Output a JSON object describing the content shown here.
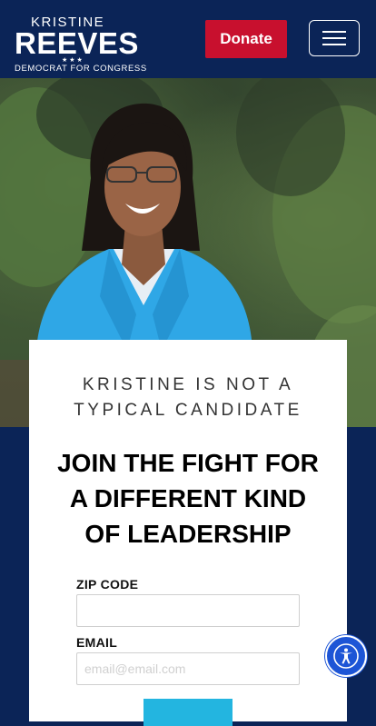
{
  "header": {
    "logo_top": "KRISTINE",
    "logo_main": "REEVES",
    "logo_stars": "★★★",
    "logo_sub": "DEMOCRAT FOR CONGRESS",
    "donate_label": "Donate"
  },
  "card": {
    "tagline_line1": "KRISTINE IS NOT A",
    "tagline_line2": "TYPICAL CANDIDATE",
    "headline_line1": "JOIN THE FIGHT FOR",
    "headline_line2": "A DIFFERENT KIND",
    "headline_line3": "OF LEADERSHIP",
    "zip_label": "ZIP CODE",
    "zip_value": "",
    "email_label": "EMAIL",
    "email_placeholder": "email@email.com"
  },
  "icons": {
    "menu": "hamburger-menu-icon",
    "accessibility": "accessibility-icon"
  },
  "colors": {
    "navy": "#0b2457",
    "donate_red": "#c8102e",
    "submit_blue": "#23b5e0",
    "a11y_blue": "#1d55d6"
  }
}
